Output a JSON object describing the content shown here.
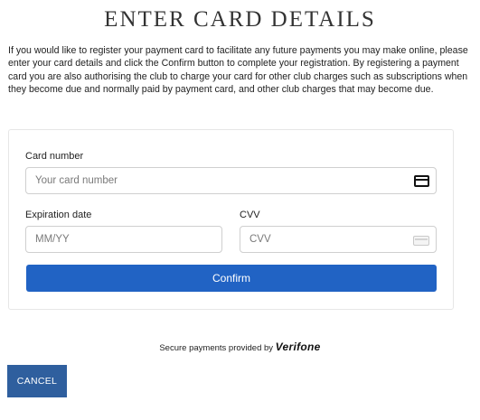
{
  "header": {
    "title": "ENTER CARD DETAILS"
  },
  "intro": {
    "text": "If you would like to register your payment card to facilitate any future payments you may make online, please enter your card details and click the Confirm button to complete your registration. By registering a payment card you are also authorising the club to charge your card for other club charges such as subscriptions when they become due and normally paid by payment card, and other club charges that may become due."
  },
  "form": {
    "card_number": {
      "label": "Card number",
      "placeholder": "Your card number",
      "icon": "credit-card-icon"
    },
    "expiration": {
      "label": "Expiration date",
      "placeholder": "MM/YY"
    },
    "cvv": {
      "label": "CVV",
      "placeholder": "CVV",
      "icon": "card-back-icon"
    },
    "confirm_label": "Confirm",
    "confirm_color": "#2163c4"
  },
  "footer": {
    "secure_text": "Secure payments provided by",
    "brand": "Verifone",
    "cancel_label": "CANCEL",
    "cancel_color": "#2f5f9e"
  }
}
